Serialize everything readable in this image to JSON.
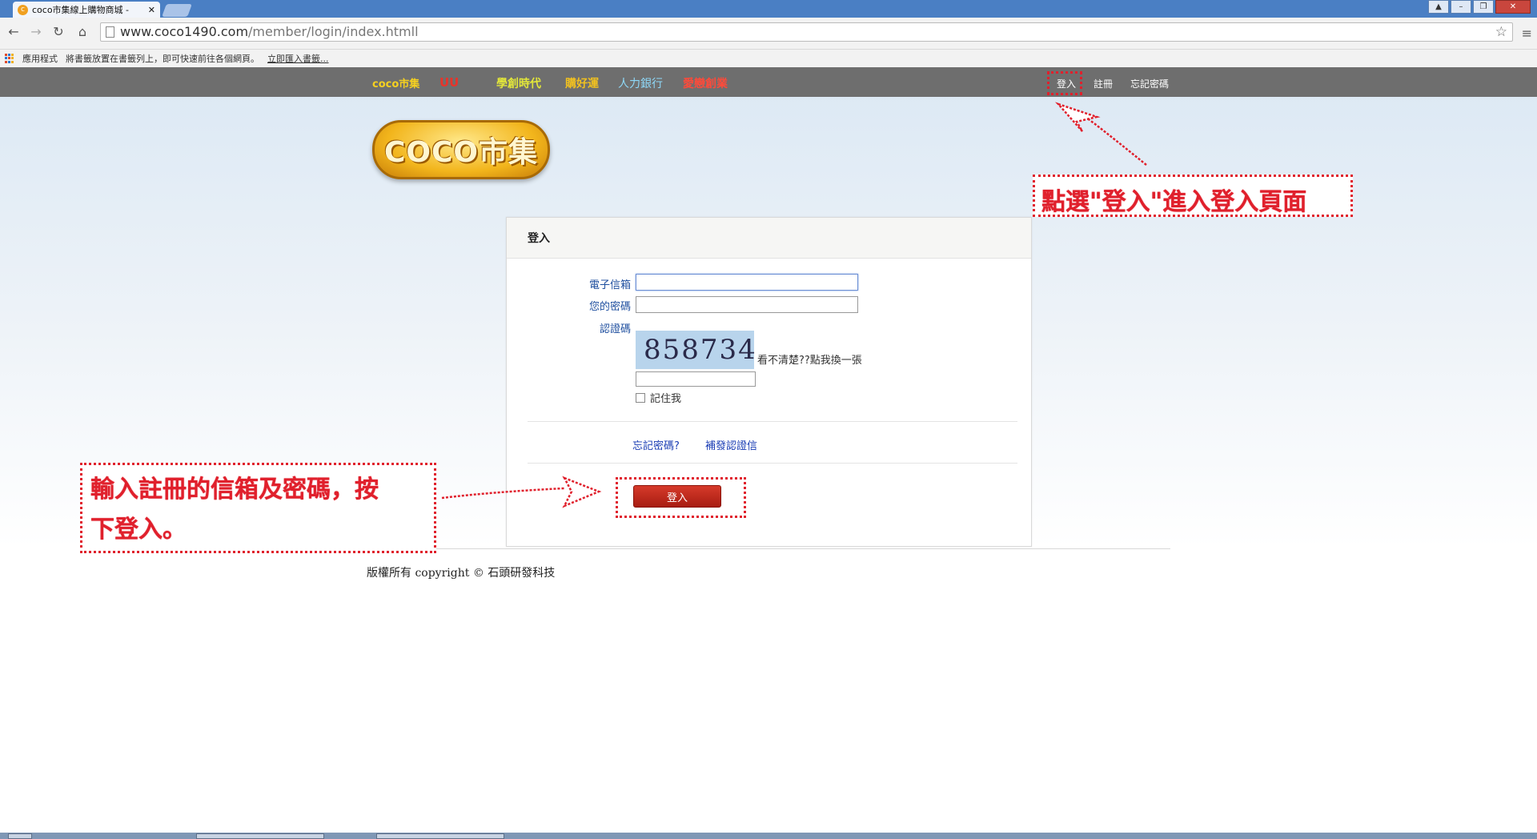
{
  "browser": {
    "tab_title": "coco市集線上購物商城 -",
    "tab_close": "✕",
    "url_host": "www.coco1490.com",
    "url_path": "/member/login/index.htmll",
    "bookmarks": {
      "apps_label": "應用程式",
      "hint": "將書籤放置在書籤列上，即可快速前往各個網頁。",
      "import_link": "立即匯入書籤..."
    }
  },
  "site": {
    "brands": [
      {
        "label": "coco市集",
        "color": "#f5d020"
      },
      {
        "label": "UU",
        "color": "#e8342a"
      },
      {
        "label": "學創時代",
        "color": "#e2e63a"
      },
      {
        "label": "購好運",
        "color": "#f0c020"
      },
      {
        "label": "人力銀行",
        "color": "#8ed8f8"
      },
      {
        "label": "愛戀創業",
        "color": "#ff4a3a"
      }
    ],
    "top_links": {
      "login": "登入",
      "register": "註冊",
      "forgot": "忘記密碼"
    },
    "logo_text": "COCO市集",
    "panel": {
      "title": "登入",
      "email_label": "電子信箱",
      "password_label": "您的密碼",
      "captcha_label": "認證碼",
      "captcha_code": "858734",
      "captcha_refresh": "看不清楚??點我換一張",
      "remember_label": "記住我",
      "forgot_link": "忘記密碼?",
      "resend_link": "補發認證信",
      "submit_label": "登入"
    },
    "footer": "版權所有 copyright © 石頭研發科技"
  },
  "annotations": {
    "top_note": "點選\"登入\"進入登入頁面",
    "bottom_note_line1": "輸入註冊的信箱及密碼，按",
    "bottom_note_line2": "下登入。",
    "color": "#e0202c"
  }
}
